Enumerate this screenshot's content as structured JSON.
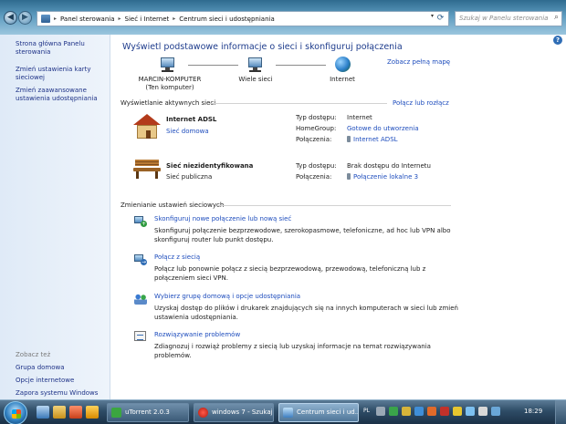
{
  "address": {
    "breadcrumbs": [
      "Panel sterowania",
      "Sieć i Internet",
      "Centrum sieci i udostępniania"
    ],
    "search_placeholder": "Szukaj w Panelu sterowania"
  },
  "sidebar": {
    "links": [
      "Strona główna Panelu sterowania",
      "Zmień ustawienia karty sieciowej",
      "Zmień zaawansowane ustawienia udostępniania"
    ],
    "see_also_heading": "Zobacz też",
    "see_also": [
      "Grupa domowa",
      "Opcje internetowe",
      "Zapora systemu Windows"
    ]
  },
  "main": {
    "title": "Wyświetl podstawowe informacje o sieci i skonfiguruj połączenia",
    "full_map_link": "Zobacz pełną mapę",
    "map_nodes": [
      {
        "label": "MARCIN-KOMPUTER",
        "sublabel": "(Ten komputer)"
      },
      {
        "label": "Wiele sieci",
        "sublabel": ""
      },
      {
        "label": "Internet",
        "sublabel": ""
      }
    ],
    "active_networks_heading": "Wyświetlanie aktywnych sieci",
    "connect_disconnect_link": "Połącz lub rozłącz",
    "networks": [
      {
        "name": "Internet ADSL",
        "type": "Sieć domowa",
        "type_is_link": true,
        "rows": [
          {
            "label": "Typ dostępu:",
            "value": "Internet",
            "link": false,
            "icon": false
          },
          {
            "label": "HomeGroup:",
            "value": "Gotowe do utworzenia",
            "link": true,
            "icon": false
          },
          {
            "label": "Połączenia:",
            "value": "Internet ADSL",
            "link": true,
            "icon": true
          }
        ]
      },
      {
        "name": "Sieć niezidentyfikowana",
        "type": "Sieć publiczna",
        "type_is_link": false,
        "rows": [
          {
            "label": "Typ dostępu:",
            "value": "Brak dostępu do Internetu",
            "link": false,
            "icon": false
          },
          {
            "label": "Połączenia:",
            "value": "Połączenie lokalne 3",
            "link": true,
            "icon": true
          }
        ]
      }
    ],
    "change_settings_heading": "Zmienianie ustawień sieciowych",
    "tasks": [
      {
        "title": "Skonfiguruj nowe połączenie lub nową sieć",
        "desc": "Skonfiguruj połączenie bezprzewodowe, szerokopasmowe, telefoniczne, ad hoc lub VPN albo skonfiguruj router lub punkt dostępu.",
        "icon": "new-connection-icon"
      },
      {
        "title": "Połącz z siecią",
        "desc": "Połącz lub ponownie połącz z siecią bezprzewodową, przewodową, telefoniczną lub z połączeniem sieci VPN.",
        "icon": "connect-network-icon"
      },
      {
        "title": "Wybierz grupę domową i opcje udostępniania",
        "desc": "Uzyskaj dostęp do plików i drukarek znajdujących się na innych komputerach w sieci lub zmień ustawienia udostępniania.",
        "icon": "homegroup-icon"
      },
      {
        "title": "Rozwiązywanie problemów",
        "desc": "Zdiagnozuj i rozwiąż problemy z siecią lub uzyskaj informacje na temat rozwiązywania problemów.",
        "icon": "troubleshoot-icon"
      }
    ]
  },
  "taskbar": {
    "buttons": [
      {
        "label": "uTorrent 2.0.3",
        "active": false
      },
      {
        "label": "windows 7 - Szukaj...",
        "active": false
      },
      {
        "label": "Centrum sieci i ud...",
        "active": true
      }
    ],
    "language": "PL",
    "clock": "18:29"
  }
}
